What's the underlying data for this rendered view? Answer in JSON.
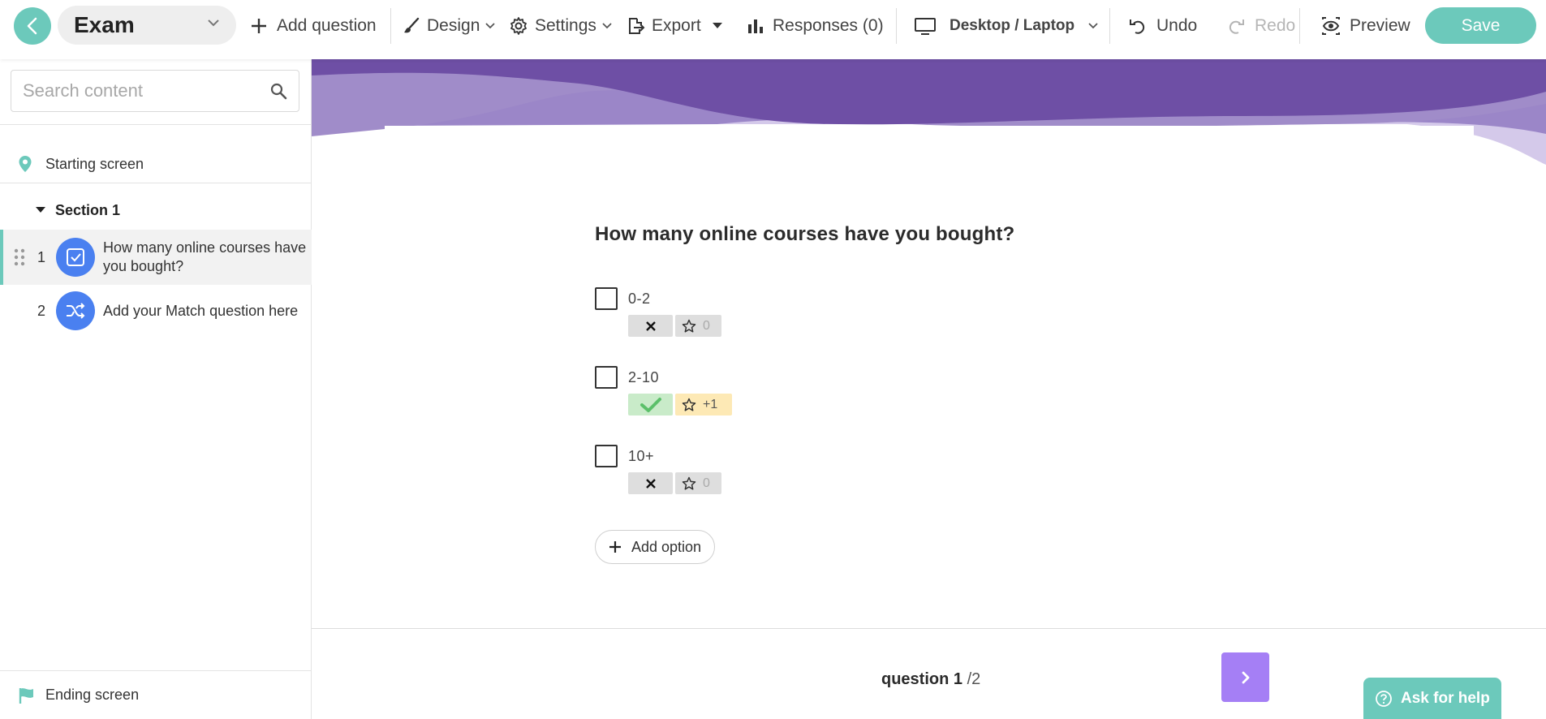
{
  "toolbar": {
    "title": "Exam",
    "add_question": "Add question",
    "design": "Design",
    "settings": "Settings",
    "export": "Export",
    "responses": "Responses (0)",
    "device": "Desktop / Laptop",
    "undo": "Undo",
    "redo": "Redo",
    "preview": "Preview",
    "save": "Save"
  },
  "sidebar": {
    "search_placeholder": "Search content",
    "starting_screen": "Starting screen",
    "section": "Section 1",
    "questions": [
      {
        "number": "1",
        "text": "How many online courses have you bought?",
        "icon": "checkbox-icon"
      },
      {
        "number": "2",
        "text": "Add your Match question here",
        "icon": "shuffle-icon"
      }
    ],
    "ending_screen": "Ending screen"
  },
  "main": {
    "question_title": "How many online courses have you bought?",
    "options": [
      {
        "label": "0-2",
        "correct": false,
        "points": "0"
      },
      {
        "label": "2-10",
        "correct": true,
        "points": "+1"
      },
      {
        "label": "10+",
        "correct": false,
        "points": "0"
      }
    ],
    "add_option": "Add option",
    "footer": {
      "counter_label": "question 1",
      "counter_total": "/2"
    }
  },
  "help": "Ask for help",
  "colors": {
    "accent_teal": "#6cc9bb",
    "question_icon_blue": "#4a80f0",
    "next_purple": "#a57ff5",
    "header_wave_purple": "#6e4fa5"
  }
}
